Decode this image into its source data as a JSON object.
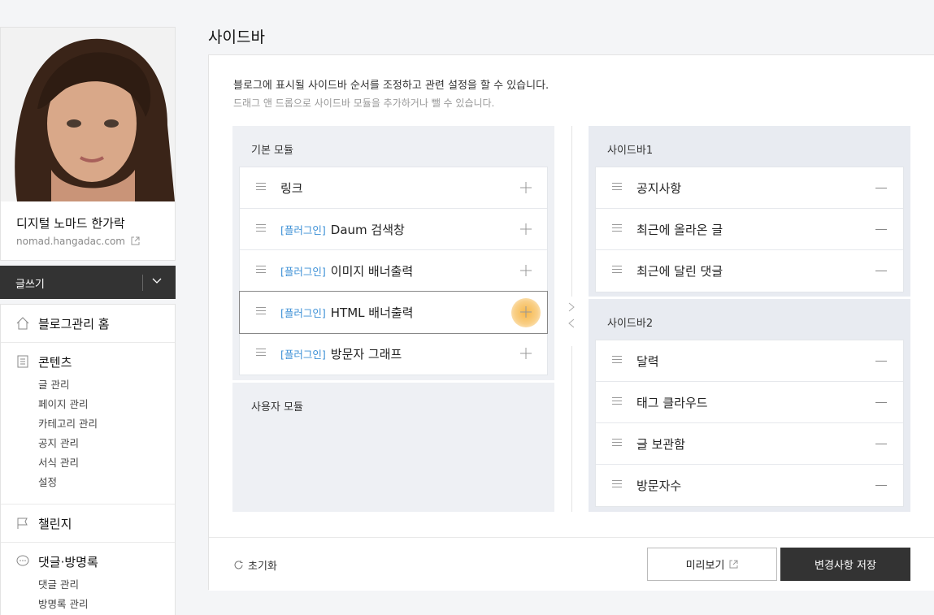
{
  "profile": {
    "blog_title": "디지털 노마드 한가락",
    "blog_url": "nomad.hangadac.com"
  },
  "write": {
    "label": "글쓰기"
  },
  "menu": {
    "home": "블로그관리 홈",
    "contents": {
      "label": "콘텐츠",
      "items": [
        "글 관리",
        "페이지 관리",
        "카테고리 관리",
        "공지 관리",
        "서식 관리",
        "설정"
      ]
    },
    "challenge": "챌린지",
    "comments": {
      "label": "댓글·방명록",
      "items": [
        "댓글 관리",
        "방명록 관리"
      ]
    }
  },
  "page": {
    "title": "사이드바",
    "desc1": "블로그에 표시될 사이드바 순서를 조정하고 관련 설정을 할 수 있습니다.",
    "desc2": "드래그 앤 드롭으로 사이드바 모듈을 추가하거나 뺄 수 있습니다."
  },
  "basic_modules": {
    "label": "기본 모듈",
    "plugin_tag": "[플러그인]",
    "items": [
      {
        "tag": "",
        "name": "링크"
      },
      {
        "tag": "[플러그인]",
        "name": "Daum 검색창"
      },
      {
        "tag": "[플러그인]",
        "name": "이미지 배너출력"
      },
      {
        "tag": "[플러그인]",
        "name": "HTML 배너출력"
      },
      {
        "tag": "[플러그인]",
        "name": "방문자 그래프"
      }
    ]
  },
  "user_modules": {
    "label": "사용자 모듈"
  },
  "sidebar1": {
    "label": "사이드바1",
    "items": [
      "공지사항",
      "최근에 올라온 글",
      "최근에 달린 댓글"
    ]
  },
  "sidebar2": {
    "label": "사이드바2",
    "items": [
      "달력",
      "태그 클라우드",
      "글 보관함",
      "방문자수"
    ]
  },
  "footer": {
    "reset": "초기화",
    "preview": "미리보기",
    "save": "변경사항 저장"
  },
  "colors": {
    "plugin_tag": "#3b8fd6",
    "highlight": "#f7b74a",
    "dark_button": "#333333"
  }
}
